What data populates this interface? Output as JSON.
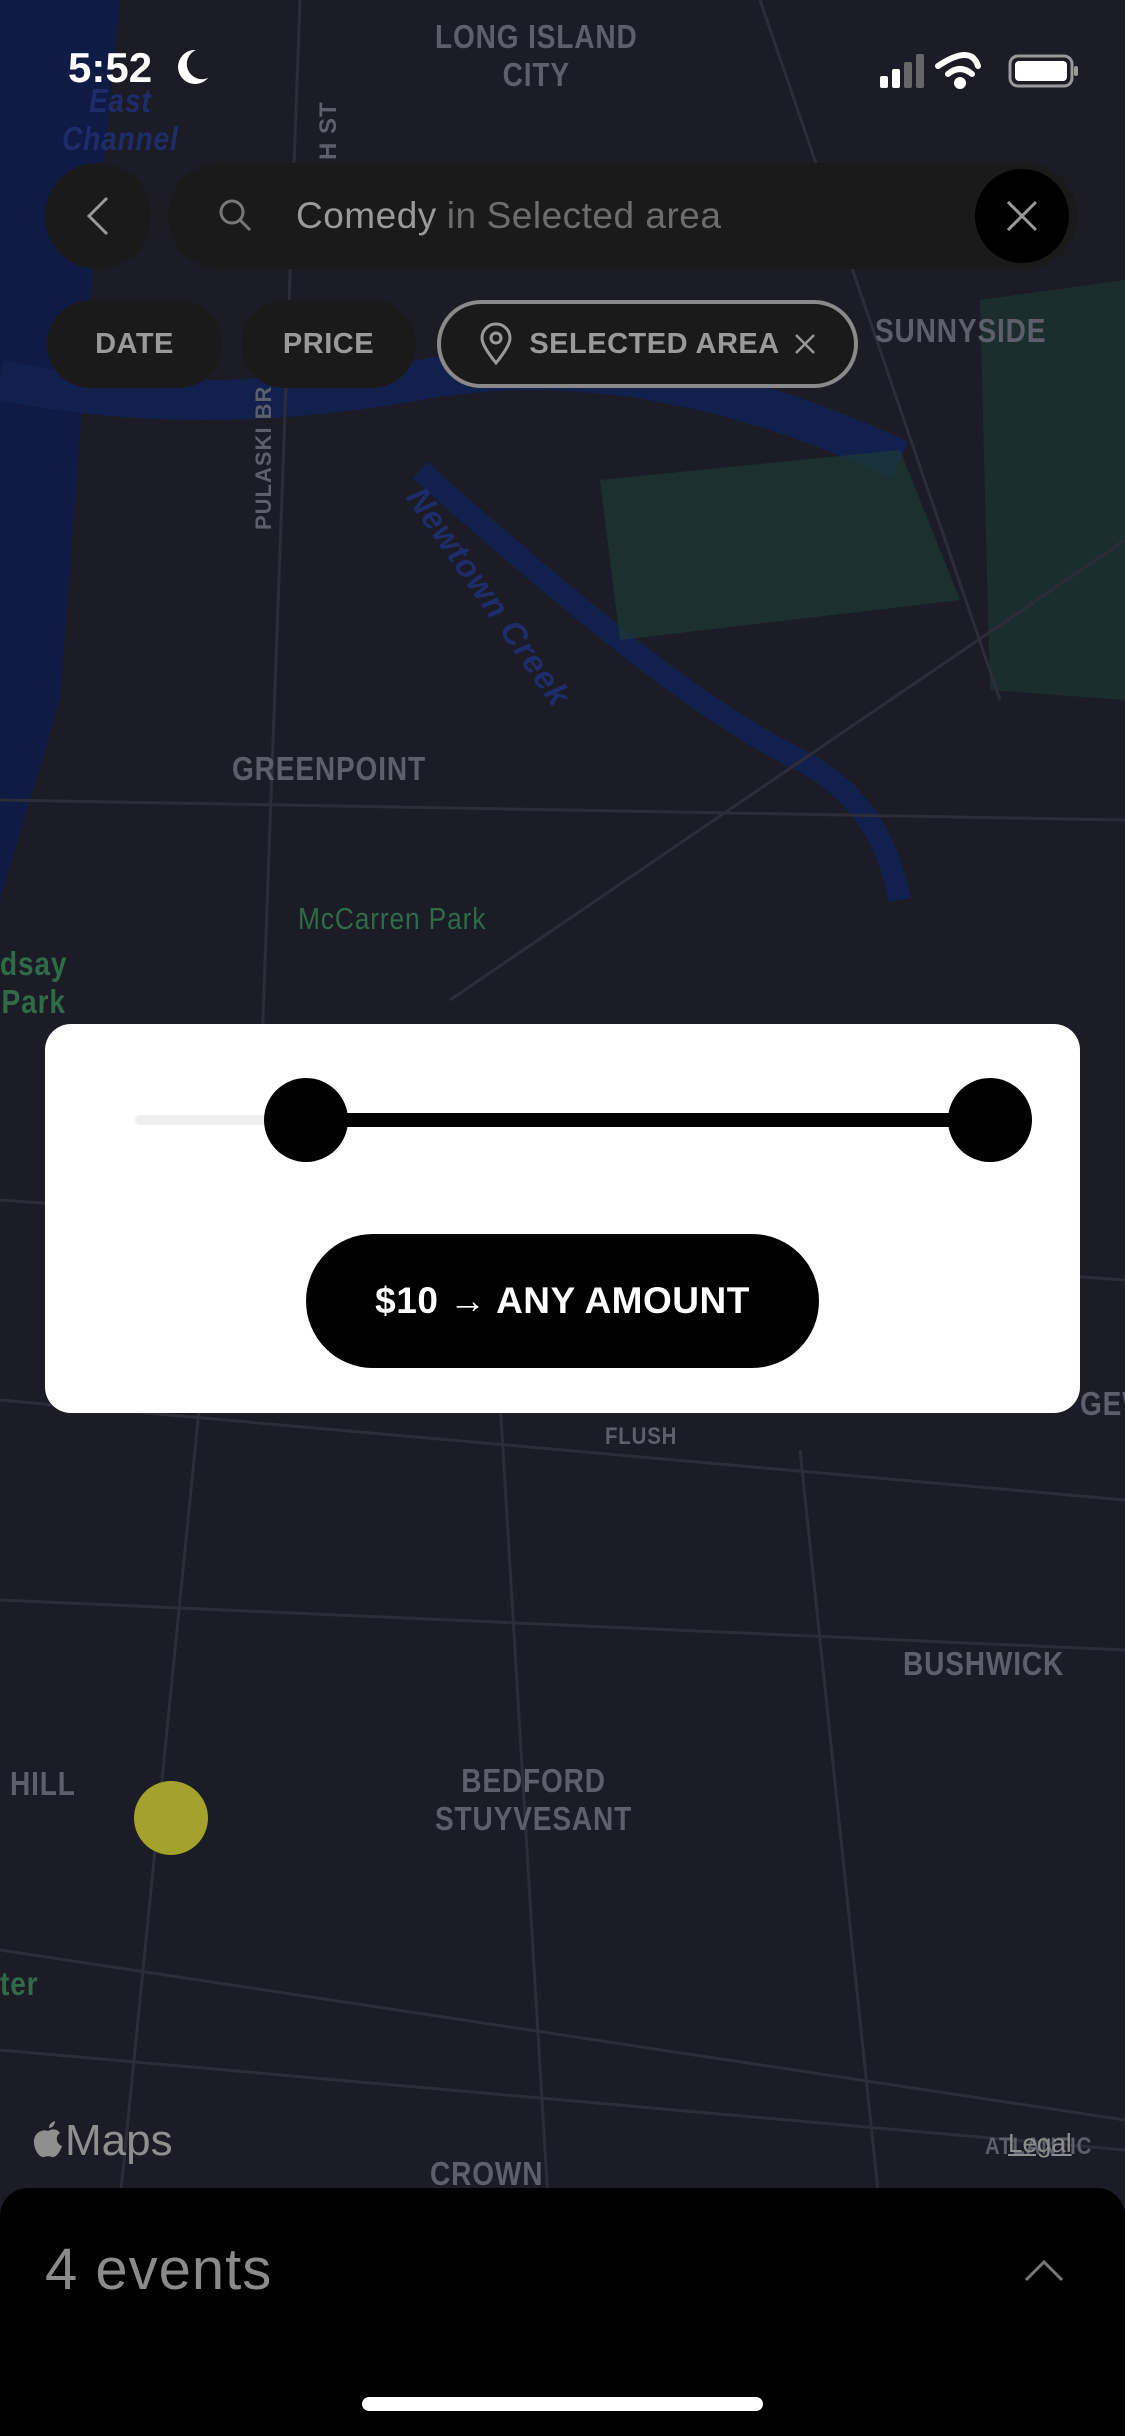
{
  "status_bar": {
    "time": "5:52",
    "icons": [
      "moon-icon",
      "cellular-signal-icon",
      "wifi-icon",
      "battery-icon"
    ]
  },
  "map": {
    "labels": [
      "LONG ISLAND\nCITY",
      "East\nChannel",
      "SUNNYSIDE",
      "GREENPOINT",
      "McCarren Park",
      "Newtown Creek",
      "BUSHWICK",
      "BEDFORD\nSTUYVESANT",
      "CROWN",
      "HILL",
      "dsay\nPark",
      "ter",
      "PULASKI BR",
      "H ST",
      "FLUSH",
      "GEW",
      "ATLANTIC"
    ],
    "marker_color": "#a3a22c",
    "attribution": "Maps",
    "legal": "Legal"
  },
  "search": {
    "back_icon": "chevron-left-icon",
    "icon": "search-icon",
    "query": "Comedy",
    "connector": "in",
    "area": "Selected area",
    "clear_icon": "close-icon"
  },
  "filters": [
    {
      "label": "DATE"
    },
    {
      "label": "PRICE"
    },
    {
      "label": "SELECTED AREA",
      "icon": "map-pin-icon",
      "remove_icon": "close-icon",
      "active": true
    }
  ],
  "price_slider": {
    "min_value": 10,
    "max_value": "any",
    "lower_fraction": 0.18,
    "upper_fraction": 1.0,
    "button_label": "$10 → ANY AMOUNT"
  },
  "bottom_sheet": {
    "title": "4 events",
    "expand_icon": "chevron-up-icon"
  }
}
